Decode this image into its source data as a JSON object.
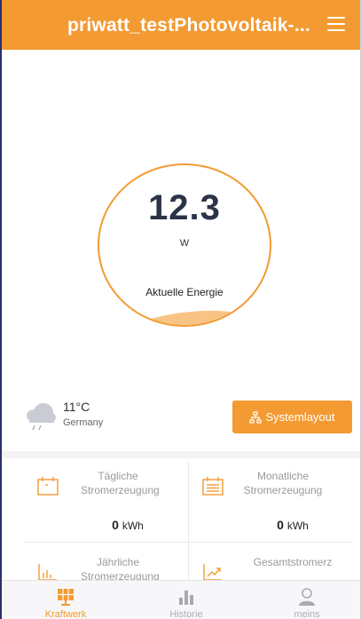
{
  "header": {
    "title": "priwatt_testPhotovoltaik-..."
  },
  "energy": {
    "value": "12.3",
    "unit": "W",
    "label": "Aktuelle Energie"
  },
  "weather": {
    "icon": "cloud-rain-icon",
    "temperature": "11°C",
    "location": "Germany"
  },
  "system_button": {
    "label": "Systemlayout",
    "icon": "network-icon"
  },
  "stats": [
    {
      "title": "Tägliche Stromerzeugung",
      "value": "0",
      "unit": "kWh",
      "icon": "calendar-day-icon"
    },
    {
      "title": "Monatliche Stromerzeugung",
      "value": "0",
      "unit": "kWh",
      "icon": "calendar-month-icon"
    },
    {
      "title": "Jährliche Stromerzeugung",
      "value": "",
      "unit": "",
      "icon": "bar-chart-icon"
    },
    {
      "title": "Gesamtstromerz",
      "value": "",
      "unit": "",
      "icon": "trend-icon"
    }
  ],
  "tabs": [
    {
      "label": "Kraftwerk",
      "icon": "solar-panel-icon",
      "active": true
    },
    {
      "label": "Historie",
      "icon": "bar-chart-icon",
      "active": false
    },
    {
      "label": "meins",
      "icon": "person-icon",
      "active": false
    }
  ],
  "colors": {
    "accent": "#f39a32",
    "text_dark": "#2c3349",
    "muted": "#9a9a9a"
  }
}
